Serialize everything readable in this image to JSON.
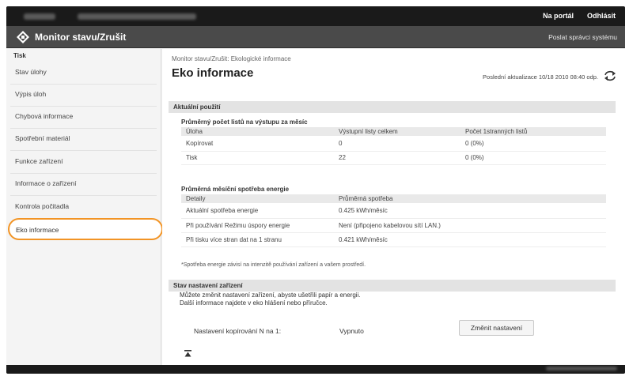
{
  "topbar": {
    "portal_link": "Na portál",
    "logout_link": "Odhlásit"
  },
  "header": {
    "title": "Monitor stavu/Zrušit",
    "send_admin": "Poslat správci systému",
    "logo_icon": "canon-remote-ui-logo"
  },
  "sidebar": {
    "group_label": "Tisk",
    "items": [
      {
        "label": "Stav úlohy"
      },
      {
        "label": "Výpis úloh"
      },
      {
        "label": "Chybová informace"
      },
      {
        "label": "Spotřební materiál"
      },
      {
        "label": "Funkce zařízení"
      },
      {
        "label": "Informace o zařízení"
      },
      {
        "label": "Kontrola počitadla"
      },
      {
        "label": "Eko informace"
      }
    ],
    "highlight_color": "#f29425"
  },
  "main": {
    "breadcrumb": "Monitor stavu/Zrušit: Ekologické informace",
    "title": "Eko informace",
    "last_update": "Poslední aktualizace 10/18 2010 08:40 odp.",
    "refresh_icon": "refresh-icon",
    "current_usage": {
      "header": "Aktuální použití",
      "pages_title": "Průměrný počet listů na výstupu za měsíc",
      "pages_columns": [
        "Úloha",
        "Výstupní listy celkem",
        "Počet 1stranných listů"
      ],
      "pages_rows": [
        [
          "Kopírovat",
          "0",
          "0 (0%)"
        ],
        [
          "Tisk",
          "22",
          "0 (0%)"
        ]
      ],
      "energy_title": "Průměrná měsíční spotřeba energie",
      "energy_columns": [
        "Detaily",
        "Průměrná spotřeba"
      ],
      "energy_rows": [
        [
          "Aktuální spotřeba energie",
          "0.425  kWh/měsíc"
        ],
        [
          "Při používání Režimu úspory energie",
          "Není (připojeno kabelovou sítí LAN.)"
        ],
        [
          "Při tisku více stran dat na 1 stranu",
          "0.421  kWh/měsíc"
        ]
      ],
      "note": "*Spotřeba energie závisí na intenzitě používání zařízení a vašem prostředí."
    },
    "settings": {
      "header": "Stav nastavení zařízení",
      "line1": "Můžete změnit nastavení zařízení, abyste ušetřili papír a energii.",
      "line2": "Další informace najdete v eko hlášení nebo příručce.",
      "nup_label": "Nastavení kopírování N na 1:",
      "nup_value": "Vypnuto",
      "change_button": "Změnit nastavení"
    },
    "top_icon": "back-to-top-icon"
  }
}
